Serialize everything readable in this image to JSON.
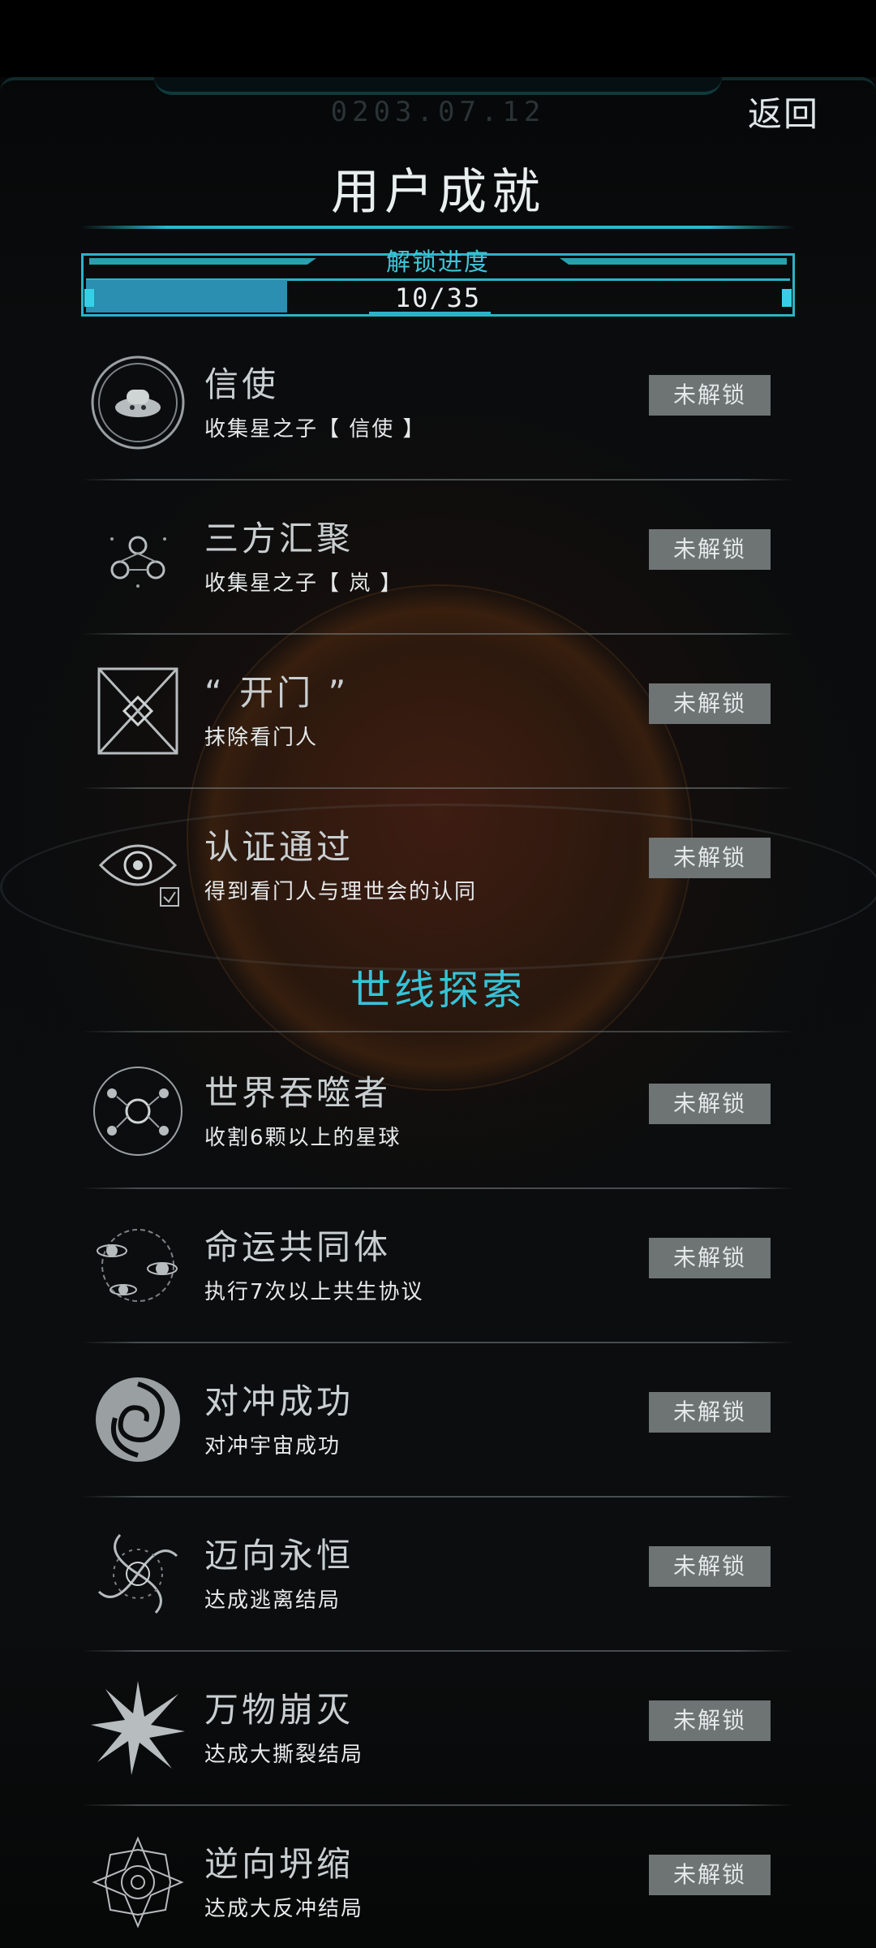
{
  "header": {
    "date": "0203.07.12",
    "back_label": "返回",
    "title": "用户成就"
  },
  "progress": {
    "label": "解锁进度",
    "unlocked": 10,
    "total": 35,
    "text": "10/35"
  },
  "section_title": "世线探索",
  "achievements": [
    {
      "name": "信使",
      "desc": "收集星之子【 信使 】",
      "status": "未解锁",
      "icon": "messenger-ship-icon"
    },
    {
      "name": "三方汇聚",
      "desc": "收集星之子【 岚 】",
      "status": "未解锁",
      "icon": "triple-convergence-icon"
    },
    {
      "name": "“ 开门 ”",
      "desc": "抹除看门人",
      "status": "未解锁",
      "icon": "gate-icon"
    },
    {
      "name": "认证通过",
      "desc": "得到看门人与理世会的认同",
      "status": "未解锁",
      "icon": "eye-verification-icon"
    },
    {
      "name": "世界吞噬者",
      "desc": "收割6颗以上的星球",
      "status": "未解锁",
      "icon": "world-devourer-icon"
    },
    {
      "name": "命运共同体",
      "desc": "执行7次以上共生协议",
      "status": "未解锁",
      "icon": "orbit-planets-icon"
    },
    {
      "name": "对冲成功",
      "desc": "对冲宇宙成功",
      "status": "未解锁",
      "icon": "swirl-icon"
    },
    {
      "name": "迈向永恒",
      "desc": "达成逃离结局",
      "status": "未解锁",
      "icon": "vortex-icon"
    },
    {
      "name": "万物崩灭",
      "desc": "达成大撕裂结局",
      "status": "未解锁",
      "icon": "starburst-icon"
    },
    {
      "name": "逆向坍缩",
      "desc": "达成大反冲结局",
      "status": "未解锁",
      "icon": "mandala-icon"
    }
  ],
  "colors": {
    "accent": "#2bb4c8",
    "button_bg": "#6e7374",
    "background": "#0a0c0d"
  }
}
